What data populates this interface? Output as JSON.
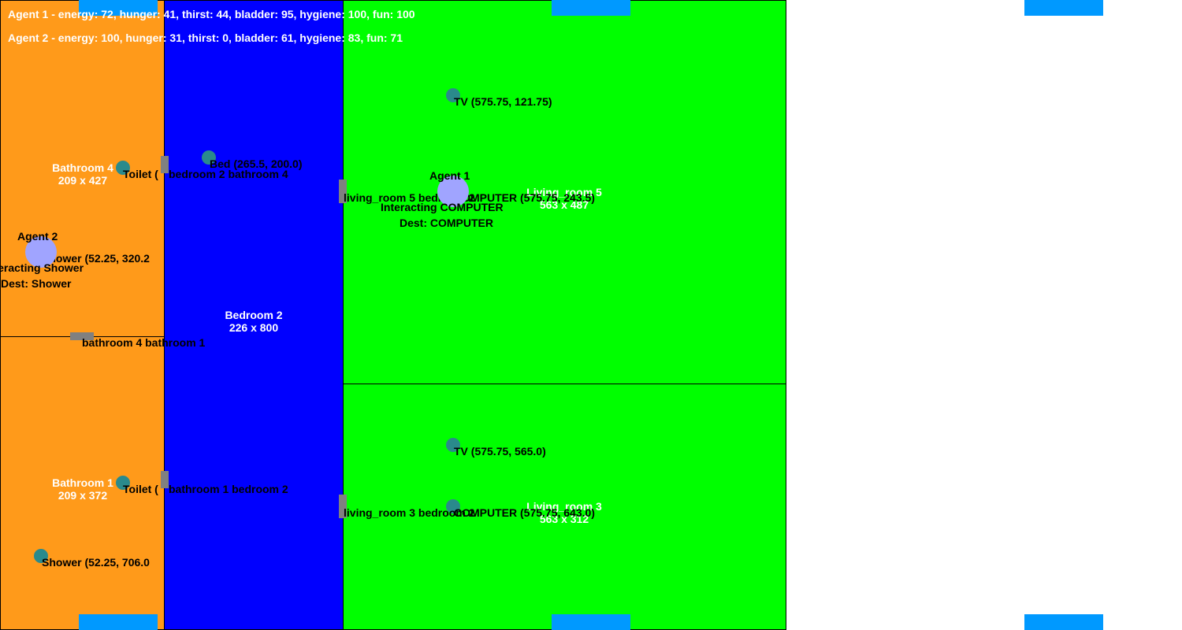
{
  "colors": {
    "bathroom": "#ff9a1a",
    "bedroom": "#0000ff",
    "living_room": "#00ff00",
    "window": "#0099ff",
    "door": "#808080",
    "object": "#2a8a8c",
    "agent": "#a0a4ff"
  },
  "hud": {
    "agent1": "Agent 1 - energy: 72, hunger: 41, thirst: 44, bladder: 95, hygiene: 100, fun: 100",
    "agent2": "Agent 2 - energy: 100, hunger: 31, thirst: 0, bladder: 61, hygiene: 83, fun: 71"
  },
  "rooms": {
    "bathroom4": {
      "name": "Bathroom 4",
      "size": "209 x 427"
    },
    "bathroom1": {
      "name": "Bathroom 1",
      "size": "209 x 372"
    },
    "bedroom2": {
      "name": "Bedroom 2",
      "size": "226 x 800"
    },
    "living5": {
      "name": "Living_room 5",
      "size": "563 x 487"
    },
    "living3": {
      "name": "Living_room 3",
      "size": "563 x 312"
    }
  },
  "objects": {
    "tv5": "TV (575.75, 121.75)",
    "bed": "Bed (265.5, 200.0)",
    "toilet4": "Toilet (",
    "shower4": "Shower (52.25, 320.2",
    "computer5": "COMPUTER (575.75, 243.5)",
    "tv3": "TV (575.75, 565.0)",
    "computer3": "COMPUTER (575.75, 643.0)",
    "toilet1": "Toilet (",
    "shower1": "Shower (52.25, 706.0"
  },
  "doors": {
    "bed2_bath4": "bedroom 2 bathroom 4",
    "bath4_bath1": "bathroom 4 bathroom 1",
    "bath1_bed2": "bathroom 1 bedroom 2",
    "living5_bed2": "living_room 5 bedroom 2",
    "living3_bed2": "living_room 3 bedroom 2"
  },
  "agents": {
    "agent1": {
      "name": "Agent 1",
      "status": "Interacting COMPUTER",
      "dest": "Dest: COMPUTER"
    },
    "agent2": {
      "name": "Agent 2",
      "status": "Interacting Shower",
      "dest": "Dest: Shower"
    }
  }
}
